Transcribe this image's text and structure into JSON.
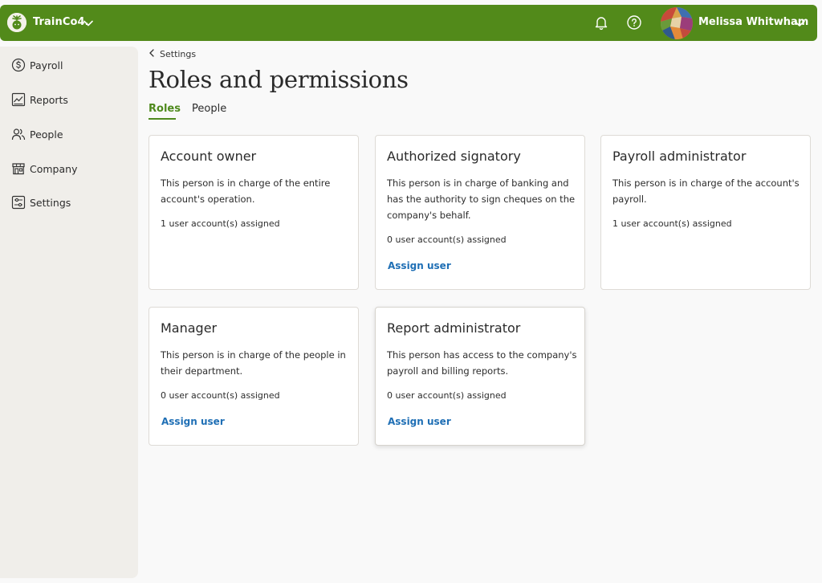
{
  "topbar": {
    "org_name": "TrainCo4.",
    "user_name": "Melissa Whitwham",
    "brand_color": "#528a1a",
    "icons": [
      "bell-icon",
      "help-icon",
      "chevron-down-icon"
    ]
  },
  "sidebar": {
    "items": [
      {
        "label": "Payroll",
        "icon": "dollar-circle-icon"
      },
      {
        "label": "Reports",
        "icon": "chart-icon"
      },
      {
        "label": "People",
        "icon": "people-icon"
      },
      {
        "label": "Company",
        "icon": "storefront-icon"
      },
      {
        "label": "Settings",
        "icon": "sliders-icon"
      }
    ]
  },
  "breadcrumb": {
    "label": "Settings"
  },
  "page": {
    "title": "Roles and permissions"
  },
  "tabs": [
    {
      "label": "Roles",
      "active": true
    },
    {
      "label": "People",
      "active": false
    }
  ],
  "roles": [
    {
      "title": "Account owner",
      "description": "This person is in charge of the entire account's operation.",
      "assigned": "1 user account(s) assigned",
      "assign_label": ""
    },
    {
      "title": "Authorized signatory",
      "description": "This person is in charge of banking and has the authority to sign cheques on the company's behalf.",
      "assigned": "0 user account(s) assigned",
      "assign_label": "Assign user"
    },
    {
      "title": "Payroll administrator",
      "description": "This person is in charge of the account's payroll.",
      "assigned": "1 user account(s) assigned",
      "assign_label": ""
    },
    {
      "title": "Manager",
      "description": "This person is in charge of the people in their department.",
      "assigned": "0 user account(s) assigned",
      "assign_label": "Assign user"
    },
    {
      "title": "Report administrator",
      "description": "This person has access to the company's payroll and billing reports.",
      "assigned": "0 user account(s) assigned",
      "assign_label": "Assign user"
    }
  ],
  "colors": {
    "accent_green": "#4f8a1d",
    "link_blue": "#1f6fb5"
  }
}
